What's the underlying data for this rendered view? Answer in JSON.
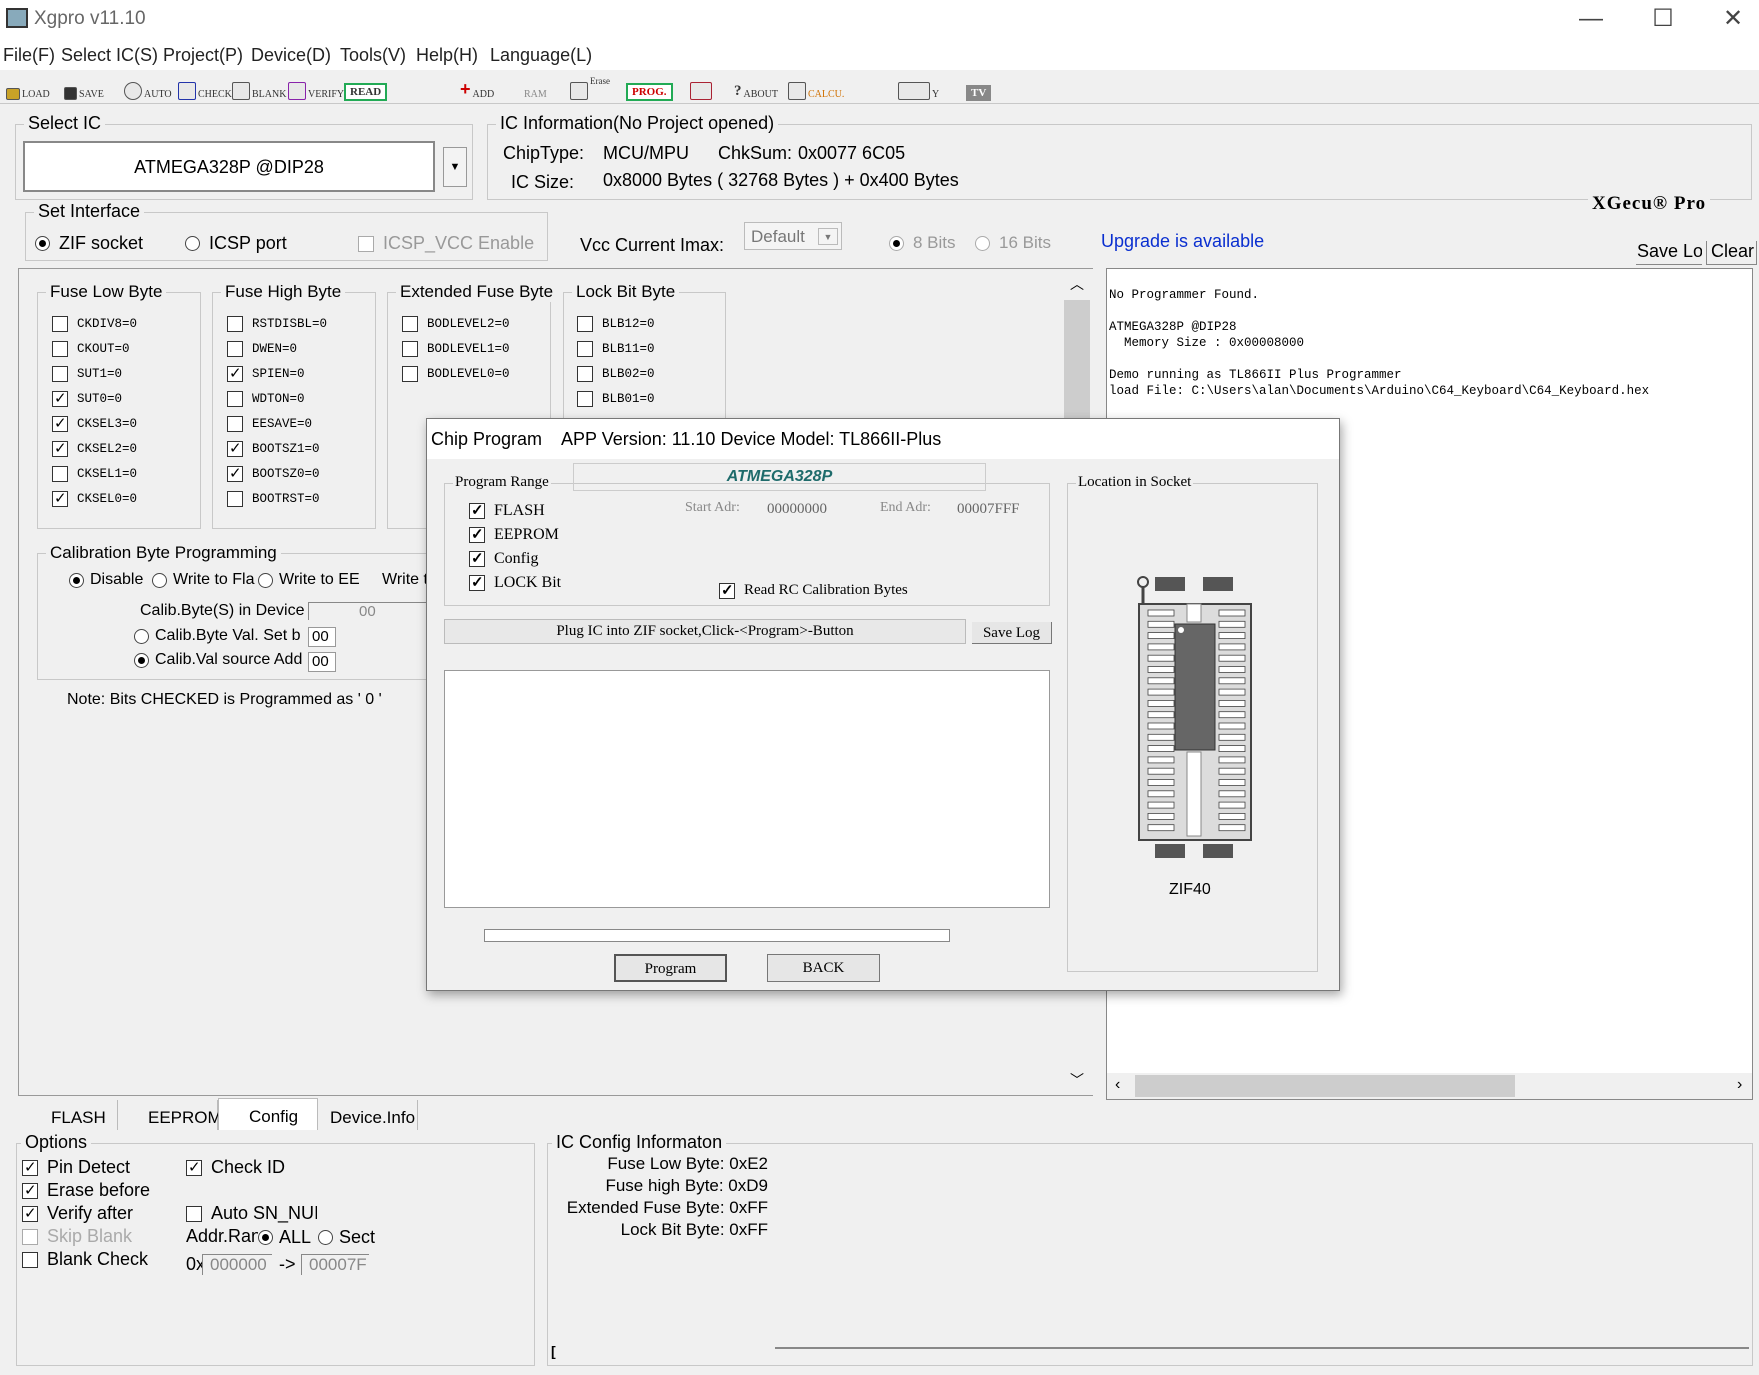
{
  "window": {
    "title": "Xgpro v11.10",
    "min": "—",
    "max": "☐",
    "close": "✕"
  },
  "menu": [
    "File(F)",
    "Select IC(S)",
    "Project(P)",
    "Device(D)",
    "Tools(V)",
    "Help(H)",
    "Language(L)"
  ],
  "toolbar": {
    "load": "LOAD",
    "save": "SAVE",
    "auto": "AUTO",
    "check": "CHECK",
    "blank": "BLANK",
    "verify": "VERIFY",
    "read": "READ",
    "add": "ADD",
    "ram": "RAM",
    "erase": "Erase",
    "prog": "PROG.",
    "about": "ABOUT",
    "calcu": "CALCU.",
    "logic": "Y",
    "tv": "TV"
  },
  "select_ic": {
    "label": "Select IC",
    "value": "ATMEGA328P @DIP28"
  },
  "ic_info": {
    "label": "IC Information(No Project opened)",
    "chiptype_label": "ChipType:",
    "chiptype": "MCU/MPU",
    "chksum_label": "ChkSum:",
    "chksum": "0x0077 6C05",
    "size_label": "IC Size:",
    "size": "0x8000 Bytes ( 32768 Bytes ) + 0x400 Bytes"
  },
  "brand": "XGecu® Pro",
  "interface": {
    "label": "Set Interface",
    "zif": "ZIF socket",
    "icsp": "ICSP port",
    "icsp_vcc": "ICSP_VCC Enable"
  },
  "vcc": {
    "label": "Vcc Current Imax:",
    "value": "Default",
    "bits8": "8 Bits",
    "bits16": "16 Bits"
  },
  "upgrade": "Upgrade is available",
  "log_buttons": {
    "save": "Save Log",
    "clear": "Clear"
  },
  "log_lines": [
    "No Programmer Found.",
    "",
    "ATMEGA328P @DIP28",
    "  Memory Size : 0x00008000",
    "",
    "Demo running as TL866II Plus Programmer",
    "load File: C:\\Users\\alan\\Documents\\Arduino\\C64_Keyboard\\C64_Keyboard.hex"
  ],
  "fuse_low": {
    "label": "Fuse Low Byte",
    "items": [
      {
        "t": "CKDIV8=0",
        "c": false
      },
      {
        "t": "CKOUT=0",
        "c": false
      },
      {
        "t": "SUT1=0",
        "c": false
      },
      {
        "t": "SUT0=0",
        "c": true
      },
      {
        "t": "CKSEL3=0",
        "c": true
      },
      {
        "t": "CKSEL2=0",
        "c": true
      },
      {
        "t": "CKSEL1=0",
        "c": false
      },
      {
        "t": "CKSEL0=0",
        "c": true
      }
    ]
  },
  "fuse_high": {
    "label": "Fuse High Byte",
    "items": [
      {
        "t": "RSTDISBL=0",
        "c": false
      },
      {
        "t": "DWEN=0",
        "c": false
      },
      {
        "t": "SPIEN=0",
        "c": true
      },
      {
        "t": "WDTON=0",
        "c": false
      },
      {
        "t": "EESAVE=0",
        "c": false
      },
      {
        "t": "BOOTSZ1=0",
        "c": true
      },
      {
        "t": "BOOTSZ0=0",
        "c": true
      },
      {
        "t": "BOOTRST=0",
        "c": false
      }
    ]
  },
  "fuse_ext": {
    "label": "Extended Fuse Byte",
    "items": [
      {
        "t": "BODLEVEL2=0",
        "c": false
      },
      {
        "t": "BODLEVEL1=0",
        "c": false
      },
      {
        "t": "BODLEVEL0=0",
        "c": false
      }
    ]
  },
  "lock": {
    "label": "Lock Bit Byte",
    "items": [
      {
        "t": "BLB12=0",
        "c": false
      },
      {
        "t": "BLB11=0",
        "c": false
      },
      {
        "t": "BLB02=0",
        "c": false
      },
      {
        "t": "BLB01=0",
        "c": false
      }
    ]
  },
  "calib": {
    "label": "Calibration Byte Programming",
    "disable": "Disable",
    "write_fla": "Write to Fla",
    "write_ee": "Write to EE",
    "write_t": "Write t",
    "in_device": "Calib.Byte(S) in Device",
    "in_device_val": "00",
    "set_by": "Calib.Byte Val. Set b",
    "set_by_val": "00",
    "source": "Calib.Val source Add",
    "source_val": "00"
  },
  "note": "Note: Bits CHECKED is Programmed as ' 0 '",
  "tabs": [
    "FLASH",
    "EEPROM",
    "Config",
    "Device.Info"
  ],
  "options": {
    "label": "Options",
    "pin_detect": "Pin Detect",
    "erase_before": "Erase before",
    "verify_after": "Verify after",
    "skip_blank": "Skip Blank",
    "blank_check": "Blank Check",
    "check_id": "Check ID",
    "auto_sn": "Auto SN_NUI",
    "addr_range": "Addr.Ran",
    "all": "ALL",
    "sect": "Sect",
    "ox": "0x",
    "from": "000000",
    "arrow": "->",
    "to": "00007F"
  },
  "config_info": {
    "label": "IC Config Informaton",
    "lines": [
      "Fuse Low Byte: 0xE2",
      "Fuse high Byte: 0xD9",
      "Extended Fuse Byte: 0xFF",
      "Lock Bit Byte: 0xFF"
    ]
  },
  "dialog": {
    "title": "Chip Program",
    "version": "APP Version: 11.10 Device Model: TL866II-Plus",
    "range_label": "Program Range",
    "chip": "ATMEGA328P",
    "flash": "FLASH",
    "eeprom": "EEPROM",
    "config": "Config",
    "lockbit": "LOCK Bit",
    "start_label": "Start Adr:",
    "start": "00000000",
    "end_label": "End Adr:",
    "end": "00007FFF",
    "read_rc": "Read RC Calibration Bytes",
    "status": "Plug IC into ZIF socket,Click-<Program>-Button",
    "save_log": "Save Log",
    "program": "Program",
    "back": "BACK",
    "socket_label": "Location in Socket",
    "socket_name": "ZIF40"
  }
}
